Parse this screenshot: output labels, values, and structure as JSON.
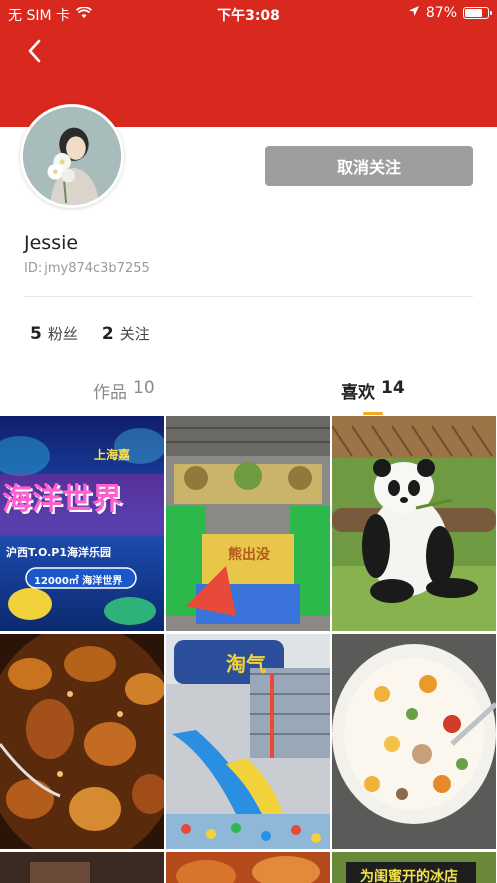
{
  "status_bar": {
    "carrier": "无 SIM 卡",
    "time": "下午3:08",
    "battery_text": "87%",
    "battery_level": 0.87
  },
  "header": {
    "background_color": "#d9281e",
    "back_icon": "chevron-left-icon"
  },
  "profile": {
    "username": "Jessie",
    "id_label": "ID:",
    "id_value": "jmy874c3b7255",
    "action_button": "取消关注"
  },
  "stats": [
    {
      "count": "5",
      "label": "粉丝"
    },
    {
      "count": "2",
      "label": "关注"
    }
  ],
  "tabs": [
    {
      "label": "作品",
      "count": "10",
      "active": false
    },
    {
      "label": "喜欢",
      "count": "14",
      "active": true
    }
  ],
  "accent_color": "#f5a623",
  "grid": {
    "tile1": {
      "line1": "上海嘉",
      "line2": "海洋世界",
      "line3": "沪西T.O.P1海洋乐园",
      "badge": "12000㎡ 海洋世界"
    },
    "tile2": {
      "sign": "熊出没"
    },
    "tile5": {
      "sign": "淘气"
    },
    "tile9": {
      "caption": "为闺蜜开的冰店"
    }
  }
}
